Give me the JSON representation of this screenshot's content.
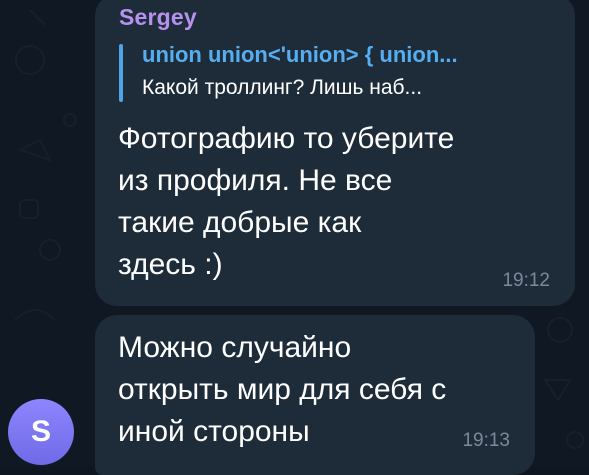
{
  "messages": [
    {
      "sender": "Sergey",
      "reply": {
        "author": "union union<'union> { union...",
        "text": "Какой троллинг? Лишь наб..."
      },
      "lines": [
        "Фотографию то уберите",
        "из профиля. Не все",
        "такие добрые как",
        "здесь :)"
      ],
      "time": "19:12"
    },
    {
      "lines": [
        "Можно случайно",
        "открыть мир для себя с",
        "иной стороны"
      ],
      "time": "19:13"
    }
  ],
  "avatar": {
    "letter": "S",
    "color": "#7d77f2"
  },
  "colors": {
    "bubble": "#1e2c3a",
    "sender": "#b692ee",
    "reply_accent": "#4fa4e6",
    "time": "#7b8a9a"
  }
}
